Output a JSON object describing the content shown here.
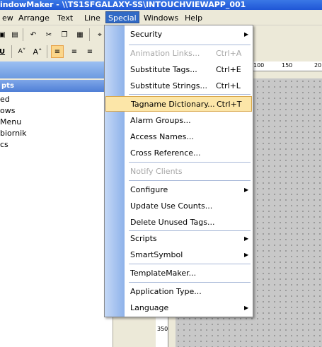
{
  "window": {
    "title": "indowMaker - \\\\TS1SFGALAXY-SS\\INTOUCHVIEWAPP_001"
  },
  "menubar": {
    "items": [
      {
        "label": "ew"
      },
      {
        "label": "Arrange"
      },
      {
        "label": "Text"
      },
      {
        "label": "Line"
      },
      {
        "label": "Special"
      },
      {
        "label": "Windows"
      },
      {
        "label": "Help"
      }
    ]
  },
  "panel": {
    "header": "pts",
    "items": [
      "ed",
      "ows",
      "Menu",
      "biornik",
      "cs"
    ]
  },
  "ruler": {
    "top_labels": [
      "100",
      "150",
      "20"
    ],
    "left_label": "350"
  },
  "special_menu": {
    "items": [
      {
        "label": "Security",
        "shortcut": "",
        "submenu": true,
        "disabled": false,
        "highlighted": false
      },
      {
        "label": "Animation Links...",
        "shortcut": "Ctrl+A",
        "submenu": false,
        "disabled": true,
        "highlighted": false
      },
      {
        "label": "Substitute Tags...",
        "shortcut": "Ctrl+E",
        "submenu": false,
        "disabled": false,
        "highlighted": false
      },
      {
        "label": "Substitute Strings...",
        "shortcut": "Ctrl+L",
        "submenu": false,
        "disabled": false,
        "highlighted": false
      },
      {
        "label": "Tagname Dictionary...",
        "shortcut": "Ctrl+T",
        "submenu": false,
        "disabled": false,
        "highlighted": true
      },
      {
        "label": "Alarm Groups...",
        "shortcut": "",
        "submenu": false,
        "disabled": false,
        "highlighted": false
      },
      {
        "label": "Access Names...",
        "shortcut": "",
        "submenu": false,
        "disabled": false,
        "highlighted": false
      },
      {
        "label": "Cross Reference...",
        "shortcut": "",
        "submenu": false,
        "disabled": false,
        "highlighted": false
      },
      {
        "label": "Notify Clients",
        "shortcut": "",
        "submenu": false,
        "disabled": true,
        "highlighted": false
      },
      {
        "label": "Configure",
        "shortcut": "",
        "submenu": true,
        "disabled": false,
        "highlighted": false
      },
      {
        "label": "Update Use Counts...",
        "shortcut": "",
        "submenu": false,
        "disabled": false,
        "highlighted": false
      },
      {
        "label": "Delete Unused Tags...",
        "shortcut": "",
        "submenu": false,
        "disabled": false,
        "highlighted": false
      },
      {
        "label": "Scripts",
        "shortcut": "",
        "submenu": true,
        "disabled": false,
        "highlighted": false
      },
      {
        "label": "SmartSymbol",
        "shortcut": "",
        "submenu": true,
        "disabled": false,
        "highlighted": false
      },
      {
        "label": "TemplateMaker...",
        "shortcut": "",
        "submenu": false,
        "disabled": false,
        "highlighted": false
      },
      {
        "label": "Application Type...",
        "shortcut": "",
        "submenu": false,
        "disabled": false,
        "highlighted": false
      },
      {
        "label": "Language",
        "shortcut": "",
        "submenu": true,
        "disabled": false,
        "highlighted": false
      }
    ]
  }
}
